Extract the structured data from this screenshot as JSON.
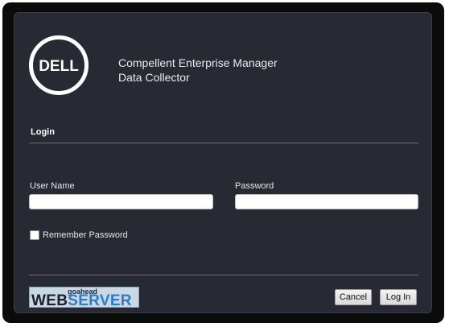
{
  "logo": {
    "text": "DELL"
  },
  "app": {
    "title_line1": "Compellent Enterprise Manager",
    "title_line2": "Data Collector"
  },
  "login": {
    "section_title": "Login",
    "username_label": "User Name",
    "username_value": "",
    "password_label": "Password",
    "password_value": "",
    "remember_label": "Remember Password",
    "remember_checked": false
  },
  "footer": {
    "badge_small": "goahead",
    "badge_web": "WEB",
    "badge_server": "SERVER",
    "cancel_label": "Cancel",
    "login_label": "Log In"
  },
  "colors": {
    "panel": "#272a33",
    "frame": "#0b0b0c",
    "badge_accent": "#2a7bd4"
  }
}
